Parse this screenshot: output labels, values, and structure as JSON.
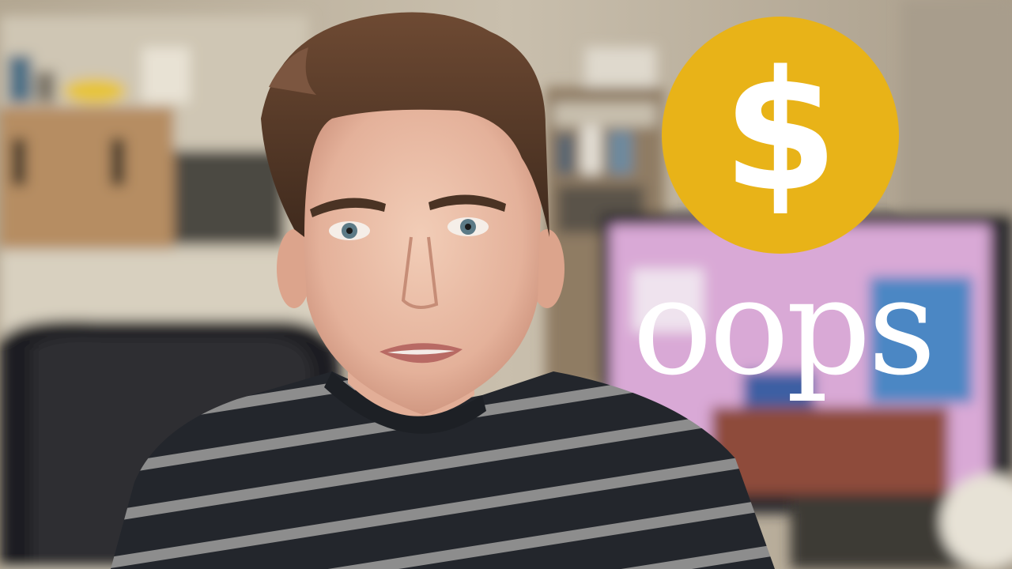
{
  "thumbnail": {
    "coin_symbol": "$",
    "caption": "oops"
  },
  "colors": {
    "coin_fill": "#e8b318",
    "caption_text": "#ffffff",
    "monitor_screen": "#d9a9d6",
    "sweater_dark": "#23262c",
    "sweater_stripe": "#8d8d8d"
  },
  "icons": {
    "coin": "dollar-coin-icon"
  }
}
